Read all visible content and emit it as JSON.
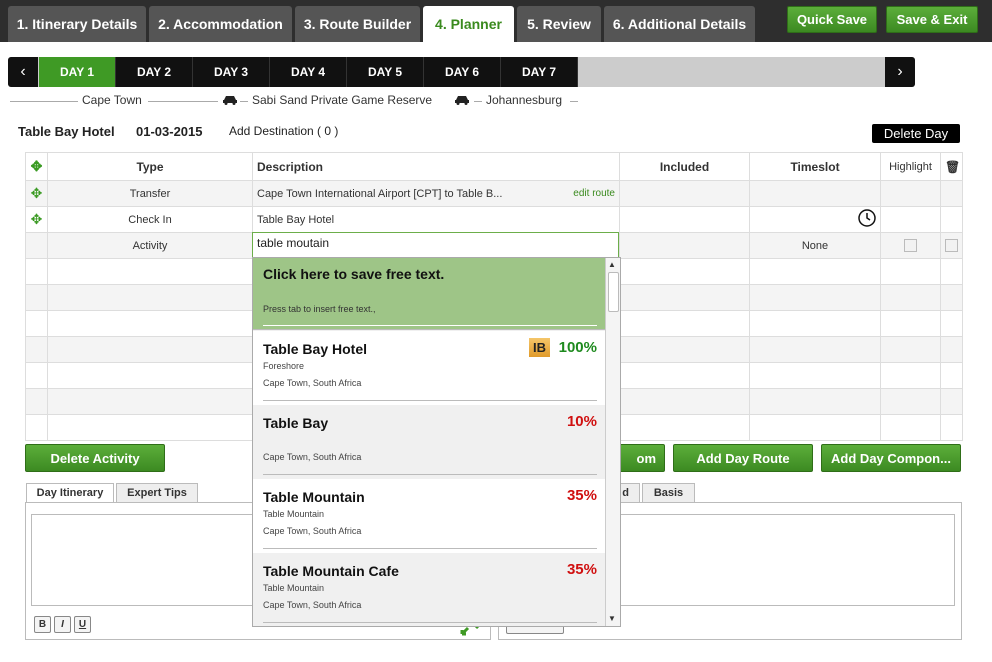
{
  "tabs": [
    {
      "label": "1. Itinerary Details"
    },
    {
      "label": "2. Accommodation"
    },
    {
      "label": "3. Route Builder"
    },
    {
      "label": "4. Planner"
    },
    {
      "label": "5. Review"
    },
    {
      "label": "6. Additional Details"
    }
  ],
  "header_buttons": {
    "quick_save": "Quick Save",
    "save_exit": "Save & Exit"
  },
  "days": [
    {
      "label": "DAY 1"
    },
    {
      "label": "DAY 2"
    },
    {
      "label": "DAY 3"
    },
    {
      "label": "DAY 4"
    },
    {
      "label": "DAY 5"
    },
    {
      "label": "DAY 6"
    },
    {
      "label": "DAY 7"
    }
  ],
  "day_nav": {
    "prev": "‹",
    "next": "›"
  },
  "route": {
    "stops": [
      "Cape Town",
      "Sabi Sand Private Game Reserve",
      "Johannesburg"
    ]
  },
  "day_header": {
    "hotel": "Table Bay Hotel",
    "date": "01-03-2015",
    "add_destination": "Add Destination ( 0 )",
    "delete_day": "Delete Day"
  },
  "grid": {
    "headers": {
      "type": "Type",
      "description": "Description",
      "included": "Included",
      "timeslot": "Timeslot",
      "highlight": "Highlight"
    },
    "rows": [
      {
        "type": "Transfer",
        "description": "Cape Town International Airport [CPT] to Table B...",
        "edit": "edit route"
      },
      {
        "type": "Check In",
        "description": "Table Bay Hotel"
      },
      {
        "type": "Activity",
        "description": "table moutain",
        "timeslot": "None"
      }
    ]
  },
  "dropdown": {
    "free_title": "Click here to save free text.",
    "free_hint": "Press tab to insert free text.,",
    "items": [
      {
        "name": "Table Bay Hotel",
        "badge": "IB",
        "pct": "100%",
        "line1": "Foreshore",
        "line2": "Cape Town, South Africa",
        "color": "#1e8a1e"
      },
      {
        "name": "Table Bay",
        "pct": "10%",
        "line1": "",
        "line2": "Cape Town, South Africa",
        "color": "#d01010"
      },
      {
        "name": "Table Mountain",
        "pct": "35%",
        "line1": "Table Mountain",
        "line2": "Cape Town, South Africa",
        "color": "#d01010"
      },
      {
        "name": "Table Mountain Cafe",
        "pct": "35%",
        "line1": "Table Mountain",
        "line2": "Cape Town, South Africa",
        "color": "#d01010"
      }
    ]
  },
  "actions": {
    "delete_activity": "Delete Activity",
    "add_custom": "om",
    "add_day_route": "Add Day Route",
    "add_day_component": "Add Day Compon..."
  },
  "subtabs_left": {
    "day_itinerary": "Day Itinerary",
    "expert_tips": "Expert Tips"
  },
  "subtabs_right": {
    "partial": "d",
    "basis": "Basis"
  },
  "format": {
    "bold": "B",
    "italic": "I",
    "underline": "U"
  },
  "colors": {
    "accent_green": "#3f9a25",
    "dropdown_free_bg": "#9ec587",
    "dark": "#2e2e2e"
  }
}
